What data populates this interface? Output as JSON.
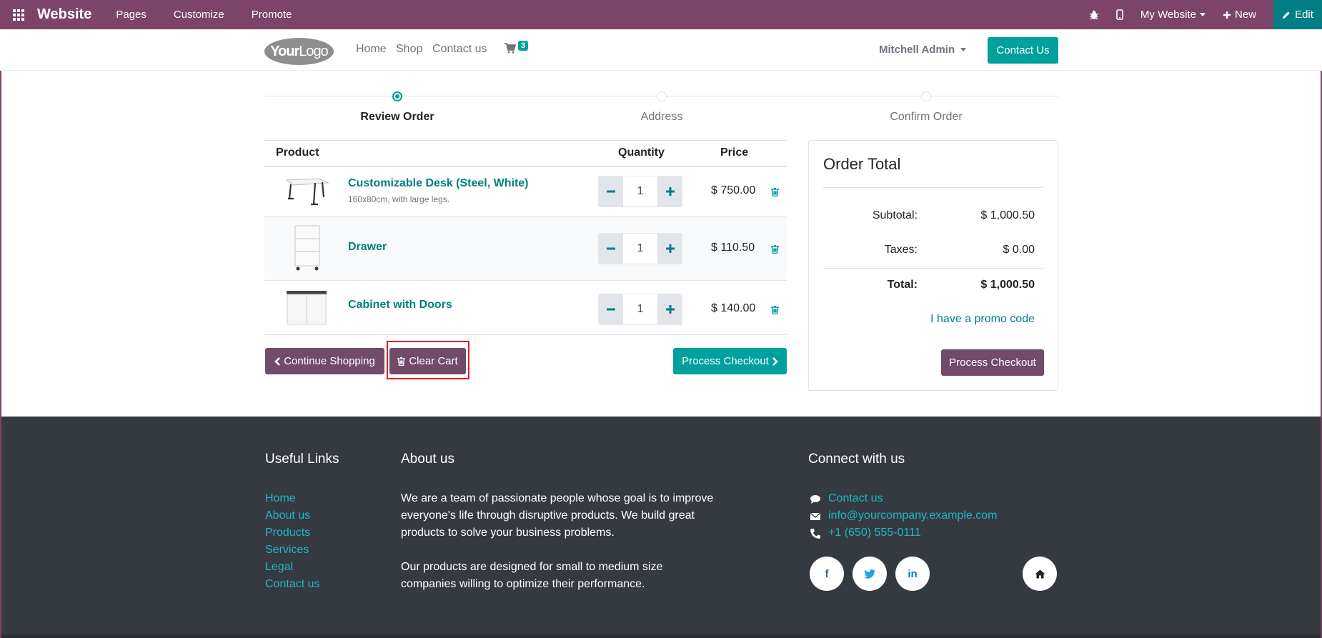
{
  "adminbar": {
    "brand": "Website",
    "menus": [
      "Pages",
      "Customize",
      "Promote"
    ],
    "site_selector": "My Website",
    "new_label": "New",
    "edit_label": "Edit"
  },
  "header": {
    "logo_bold": "Your",
    "logo_rest": "Logo",
    "nav": [
      "Home",
      "Shop",
      "Contact us"
    ],
    "cart_count": "3",
    "user": "Mitchell Admin",
    "contact_button": "Contact Us"
  },
  "steps": [
    "Review Order",
    "Address",
    "Confirm Order"
  ],
  "cart": {
    "headers": {
      "product": "Product",
      "quantity": "Quantity",
      "price": "Price"
    },
    "items": [
      {
        "name": "Customizable Desk (Steel, White)",
        "description": "160x80cm, with large legs.",
        "quantity": "1",
        "price": "$ 750.00"
      },
      {
        "name": "Drawer",
        "description": "",
        "quantity": "1",
        "price": "$ 110.50"
      },
      {
        "name": "Cabinet with Doors",
        "description": "",
        "quantity": "1",
        "price": "$ 140.00"
      }
    ],
    "continue_label": "Continue Shopping",
    "clear_label": "Clear Cart",
    "checkout_label": "Process Checkout"
  },
  "order_total": {
    "title": "Order Total",
    "subtotal_label": "Subtotal:",
    "subtotal": "$ 1,000.50",
    "taxes_label": "Taxes:",
    "taxes": "$ 0.00",
    "total_label": "Total:",
    "total": "$ 1,000.50",
    "promo": "I have a promo code",
    "checkout_label": "Process Checkout"
  },
  "footer": {
    "useful_links_title": "Useful Links",
    "useful_links": [
      "Home",
      "About us",
      "Products",
      "Services",
      "Legal",
      "Contact us"
    ],
    "about_title": "About us",
    "about_lines_1": [
      "We are a team of passionate people whose goal is to improve",
      "everyone's life through disruptive products. We build great",
      "products to solve your business problems."
    ],
    "about_lines_2": [
      "Our products are designed for small to medium size",
      "companies willing to optimize their performance."
    ],
    "connect_title": "Connect with us",
    "connect": [
      "Contact us",
      "info@yourcompany.example.com",
      "+1 (650) 555-0111"
    ],
    "social": [
      "f",
      "twitter-bird",
      "in",
      "home"
    ]
  },
  "colors": {
    "admin_bar": "#7c4468",
    "edit_button": "#017e84",
    "primary_teal": "#00a09d",
    "secondary_purple": "#714b67",
    "link_teal": "#017e84",
    "footer_bg": "#353a41",
    "footer_link": "#21b6c4"
  }
}
